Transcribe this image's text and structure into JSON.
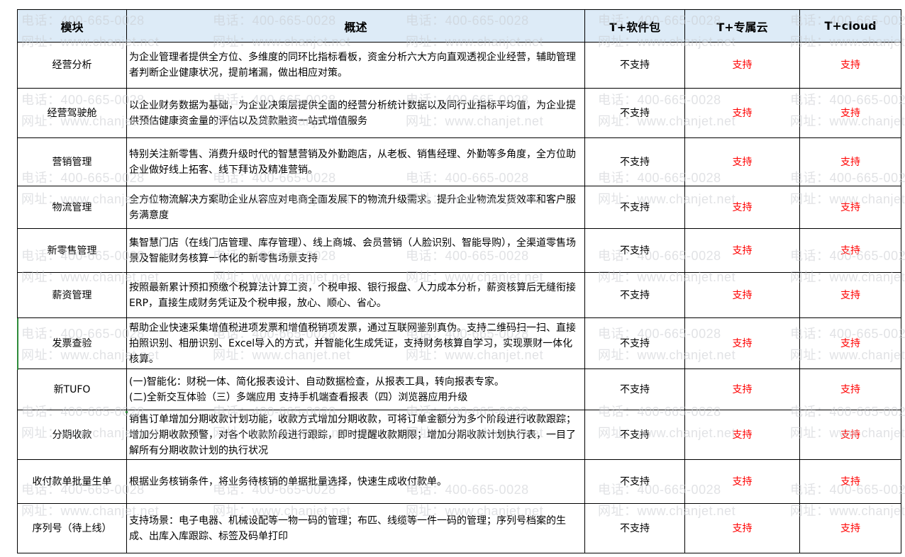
{
  "headers": {
    "module": "模块",
    "overview": "概述",
    "software": "T+软件包",
    "cloud_dedicated": "T+专属云",
    "cloud": "T+cloud"
  },
  "rows": [
    {
      "module": "经营分析",
      "desc": "为企业管理者提供全方位、多维度的同环比指标看板，资金分析六大方向直观透视企业经营，辅助管理者判断企业健康状况，提前堵漏，做出相应对策。",
      "software": "不支持",
      "cloud_dedicated": "支持",
      "cloud": "支持"
    },
    {
      "module": "经营驾驶舱",
      "desc": "以企业财务数据为基础，为企业决策层提供全面的经营分析统计数据以及同行业指标平均值，为企业提供预估健康资金量的评估以及贷款融资一站式增值服务",
      "software": "不支持",
      "cloud_dedicated": "支持",
      "cloud": "支持"
    },
    {
      "module": "营销管理",
      "desc": "特别关注新零售、消费升级时代的智慧营销及外勤跑店，从老板、销售经理、外勤等多角度，全方位助企业做好线上拓客、线下拜访及精准营销。",
      "software": "不支持",
      "cloud_dedicated": "支持",
      "cloud": "支持"
    },
    {
      "module": "物流管理",
      "desc": "全方位物流解决方案助企业从容应对电商全面发展下的物流升级需求。提升企业物流发货效率和客户服务满意度",
      "software": "不支持",
      "cloud_dedicated": "支持",
      "cloud": "支持"
    },
    {
      "module": "新零售管理",
      "desc": "集智慧门店（在线门店管理、库存管理）、线上商城、会员营销（人脸识别、智能导购），全渠道零售场景及智能财务核算一体化的新零售场景支持",
      "software": "不支持",
      "cloud_dedicated": "支持",
      "cloud": "支持"
    },
    {
      "module": "薪资管理",
      "desc": "按照最新累计预扣预缴个税算法计算工资，个税申报、银行报盘、人力成本分析，薪资核算后无缝衔接ERP，直接生成财务凭证及个税申报，放心、顺心、省心。",
      "software": "不支持",
      "cloud_dedicated": "支持",
      "cloud": "支持"
    },
    {
      "module": "发票查验",
      "desc": "帮助企业快速采集增值税进项发票和增值税销项发票，通过互联网鉴别真伪。支持二维码扫一扫、直接拍照识别、相册识别、Excel导入的方式，并智能化生成凭证，支持财务核算自学习，实现票财一体化核算。",
      "software": "不支持",
      "cloud_dedicated": "支持",
      "cloud": "支持"
    },
    {
      "module": "新TUFO",
      "desc": "(一)智能化：财税一体、简化报表设计、自动数据检查，从报表工具，转向报表专家。\n(二)全新交互体验（三）多端应用 支持手机端查看报表（四）浏览器应用升级",
      "software": "不支持",
      "cloud_dedicated": "支持",
      "cloud": "支持"
    },
    {
      "module": "分期收款",
      "desc": "销售订单增加分期收款计划功能，收款方式增加分期收款，可将订单金额分为多个阶段进行收款跟踪；增加分期收款预警，对各个收款阶段进行跟踪，即时提醒收款期限；增加分期收款计划执行表，一目了解所有分期收款计划的执行状况",
      "software": "不支持",
      "cloud_dedicated": "支持",
      "cloud": "支持"
    },
    {
      "module": "收付款单批量生单",
      "desc": "根据业务核销条件，将业务待核销的单据批量选择，快速生成收付款单。",
      "software": "不支持",
      "cloud_dedicated": "支持",
      "cloud": "支持"
    },
    {
      "module": "序列号（待上线）",
      "desc": "支持场景：电子电器、机械设配等一物一码的管理；布匹、线缆等一件一码的管理；序列号档案的生成、出库入库跟踪、标签及码单打印",
      "software": "不支持",
      "cloud_dedicated": "支持",
      "cloud": "支持"
    }
  ],
  "watermark": {
    "phone": "电话：400-665-0028",
    "site": "网址：www.chanjet.net"
  }
}
